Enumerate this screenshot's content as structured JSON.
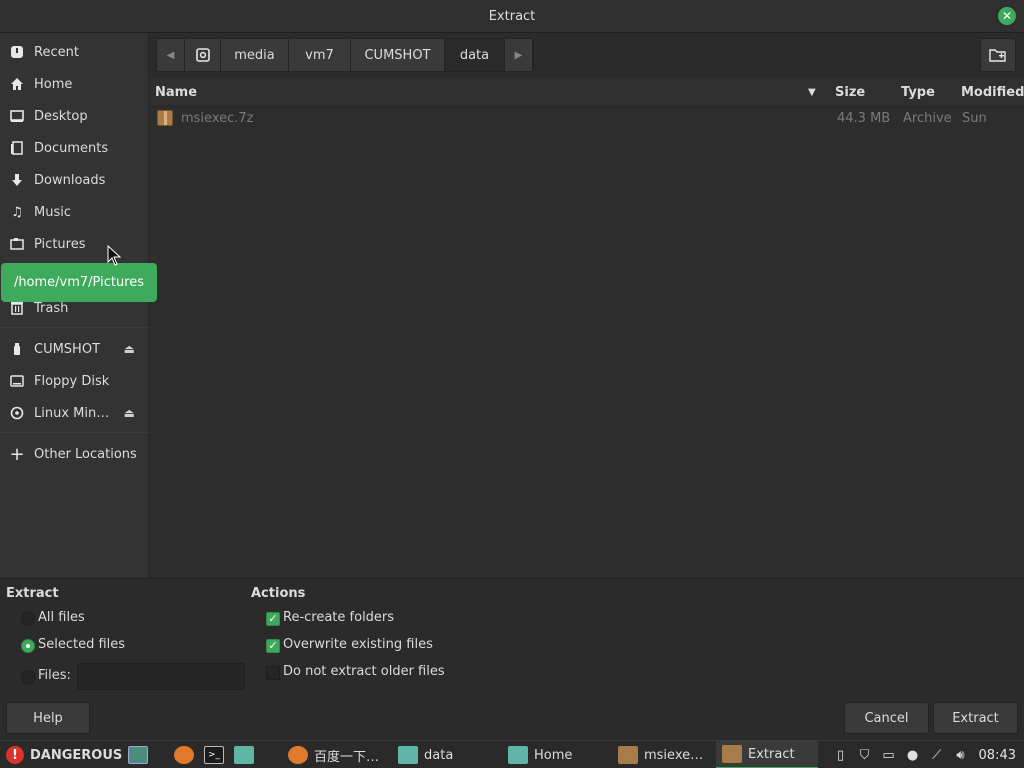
{
  "window": {
    "title": "Extract"
  },
  "sidebar": {
    "items": [
      {
        "label": "Recent",
        "icon": "clock-icon"
      },
      {
        "label": "Home",
        "icon": "home-icon"
      },
      {
        "label": "Desktop",
        "icon": "desktop-icon"
      },
      {
        "label": "Documents",
        "icon": "documents-icon"
      },
      {
        "label": "Downloads",
        "icon": "downloads-icon"
      },
      {
        "label": "Music",
        "icon": "music-icon"
      },
      {
        "label": "Pictures",
        "icon": "pictures-icon"
      },
      {
        "label": "Trash",
        "icon": "trash-icon"
      },
      {
        "label": "CUMSHOT",
        "icon": "usb-drive-icon",
        "eject": true
      },
      {
        "label": "Floppy Disk",
        "icon": "floppy-icon"
      },
      {
        "label": "Linux Min…",
        "icon": "optical-disc-icon",
        "eject": true
      },
      {
        "label": "Other Locations",
        "icon": "plus-icon"
      }
    ],
    "tooltip": "/home/vm7/Pictures"
  },
  "pathbar": {
    "crumbs": [
      "media",
      "vm7",
      "CUMSHOT",
      "data"
    ],
    "active": "data"
  },
  "columns": {
    "name": "Name",
    "size": "Size",
    "type": "Type",
    "modified": "Modified"
  },
  "files": [
    {
      "name": "msiexec.7z",
      "size": "44.3 MB",
      "type": "Archive",
      "modified": "Sun"
    }
  ],
  "extract": {
    "heading": "Extract",
    "all_files": "All files",
    "selected_files": "Selected files",
    "files_label": "Files:",
    "files_value": "",
    "selected": "selected_files"
  },
  "actions": {
    "heading": "Actions",
    "recreate": {
      "label": "Re-create folders",
      "checked": true
    },
    "overwrite": {
      "label": "Overwrite existing files",
      "checked": true
    },
    "older": {
      "label": "Do not extract older files",
      "checked": false
    }
  },
  "buttons": {
    "help": "Help",
    "cancel": "Cancel",
    "extract": "Extract"
  },
  "taskbar": {
    "warning": "DANGEROUS",
    "windows": [
      {
        "label": "百度一下…",
        "icon": "firefox-icon"
      },
      {
        "label": "data",
        "icon": "folder-icon"
      },
      {
        "label": "Home",
        "icon": "folder-icon"
      },
      {
        "label": "msiexe…",
        "icon": "archive-icon"
      },
      {
        "label": "Extract",
        "icon": "archive-icon",
        "active": true
      }
    ],
    "clock": "08:43"
  },
  "colors": {
    "accent": "#3daa5c",
    "warning": "#d9342b"
  }
}
